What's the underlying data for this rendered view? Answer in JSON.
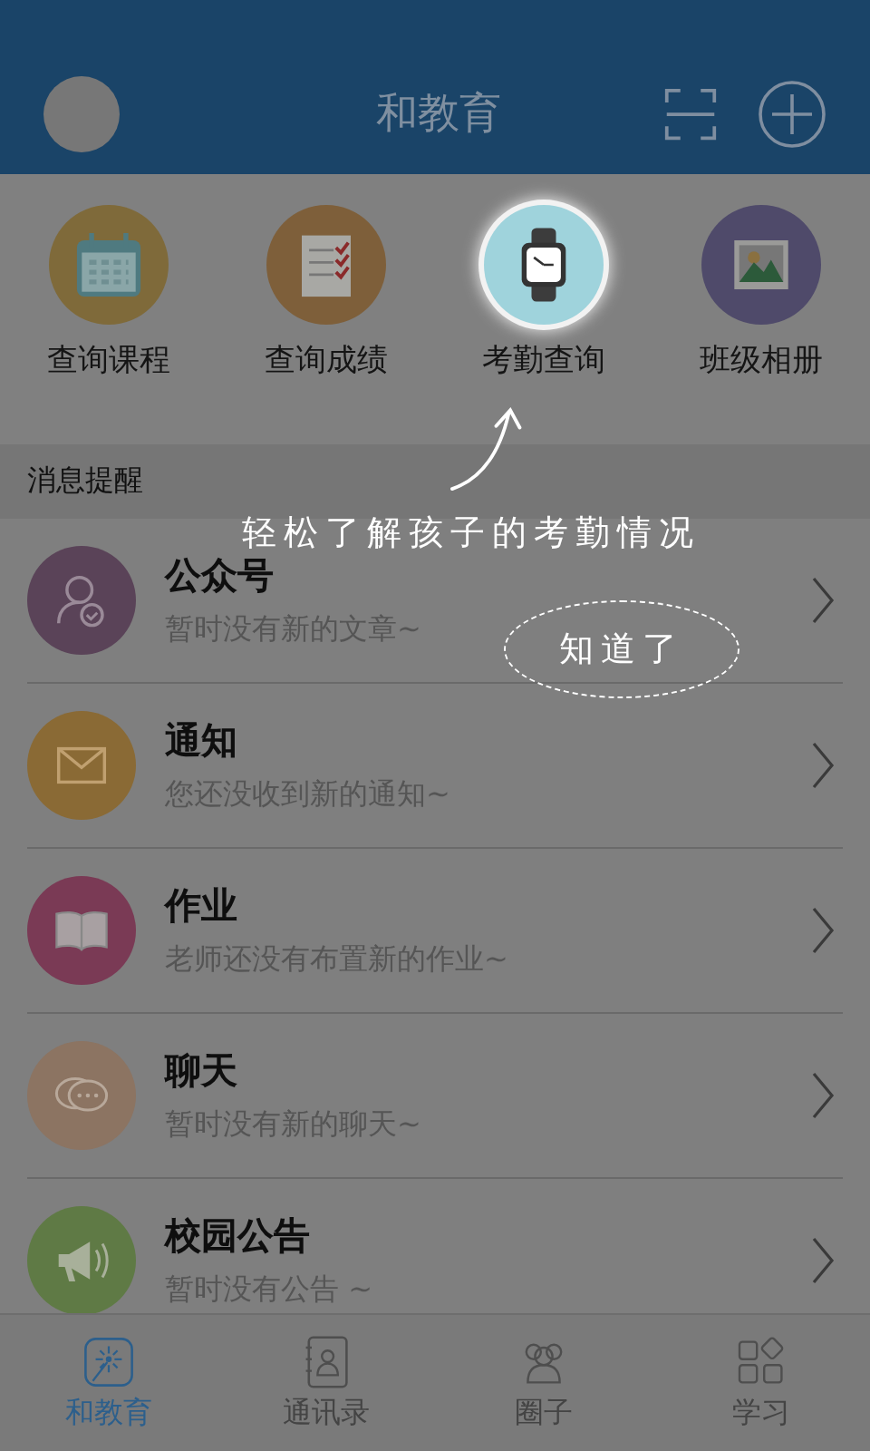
{
  "header": {
    "title": "和教育"
  },
  "shortcuts": [
    {
      "label": "查询课程",
      "kind": "calendar",
      "color": "#7f6a3a",
      "highlighted": false
    },
    {
      "label": "查询成绩",
      "kind": "checklist",
      "color": "#7e5f3a",
      "highlighted": false
    },
    {
      "label": "考勤查询",
      "kind": "watch",
      "color": "#9fd3dc",
      "highlighted": true
    },
    {
      "label": "班级相册",
      "kind": "photo",
      "color": "#4f4a6a",
      "highlighted": false
    }
  ],
  "section": {
    "title": "消息提醒"
  },
  "messages": [
    {
      "title": "公众号",
      "subtitle": "暂时没有新的文章~",
      "kind": "person",
      "color": "#5a4358"
    },
    {
      "title": "通知",
      "subtitle": "您还没收到新的通知~",
      "kind": "mail",
      "color": "#8a6a35"
    },
    {
      "title": "作业",
      "subtitle": "老师还没有布置新的作业~",
      "kind": "book",
      "color": "#7a3a55"
    },
    {
      "title": "聊天",
      "subtitle": "暂时没有新的聊天~",
      "kind": "chat",
      "color": "#8c7462"
    },
    {
      "title": "校园公告",
      "subtitle": "暂时没有公告 ~",
      "kind": "megaphone",
      "color": "#5f7a45"
    }
  ],
  "tabs": [
    {
      "label": "和教育",
      "kind": "home",
      "selected": true
    },
    {
      "label": "通讯录",
      "kind": "contacts",
      "selected": false
    },
    {
      "label": "圈子",
      "kind": "group",
      "selected": false
    },
    {
      "label": "学习",
      "kind": "apps",
      "selected": false
    }
  ],
  "guide": {
    "tip": "轻松了解孩子的考勤情况",
    "dismiss": "知道了"
  }
}
